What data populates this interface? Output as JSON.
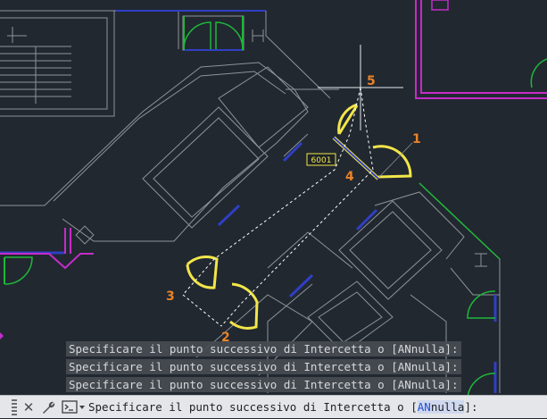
{
  "drawing": {
    "dimension_label": "6001",
    "point_labels": [
      "1",
      "2",
      "3",
      "4",
      "5"
    ]
  },
  "command_line": {
    "history": [
      "Specificare il punto successivo di Intercetta o [ANnulla]:",
      "Specificare il punto successivo di Intercetta o [ANnulla]:",
      "Specificare il punto successivo di Intercetta o [ANnulla]:"
    ],
    "prompt_before": "Specificare il punto successivo di Intercetta o [",
    "prompt_keyword": "AN",
    "prompt_rest": "nulla",
    "prompt_after": "]:",
    "icons": {
      "grip": "grip-icon",
      "close": "close-icon",
      "customize": "wrench-icon",
      "prompt": "command-prompt-icon"
    }
  },
  "colors": {
    "background": "#212830",
    "wall": "#8e9399",
    "door_highlight": "#f2e64a",
    "door_green": "#1fb83a",
    "window_blue": "#2f3fc4",
    "magenta": "#c52cc9",
    "label_orange": "#e8822a",
    "dashed_path": "#ffffff"
  }
}
